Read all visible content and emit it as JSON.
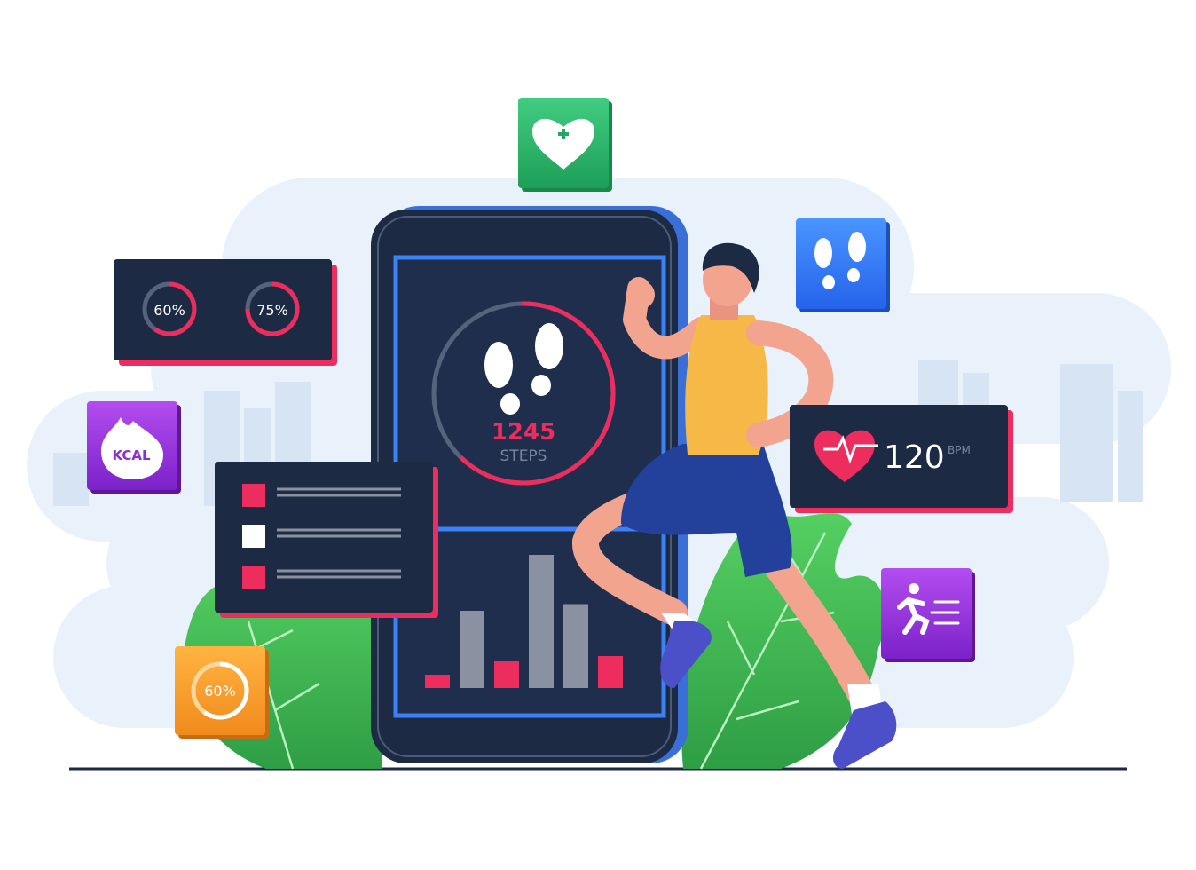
{
  "colors": {
    "navy": "#1d2a44",
    "pink": "#ec2d5d",
    "blue": "#3b82f6",
    "green": "#22a861",
    "purple": "#8b2fd1",
    "orange": "#f59b28",
    "cloud": "#e8f0fa",
    "leaf": "#3fbf4f",
    "skin": "#f2a48f",
    "shirt": "#f6b847",
    "shorts": "#23419a"
  },
  "gauges": {
    "left_pct": "60%",
    "right_pct": "75%",
    "left_value": 0.6,
    "right_value": 0.75
  },
  "kcal_badge": {
    "label": "KCAL",
    "icon": "flame-icon"
  },
  "progress_badge": {
    "pct": "60%",
    "value": 0.6
  },
  "phone": {
    "steps_value": "1245",
    "steps_label": "STEPS",
    "steps_progress": 0.62,
    "bars": [
      {
        "value": 1,
        "color": "pink"
      },
      {
        "value": 5.8,
        "color": "gray"
      },
      {
        "value": 2,
        "color": "pink"
      },
      {
        "value": 10,
        "color": "gray"
      },
      {
        "value": 6.3,
        "color": "gray"
      },
      {
        "value": 2.4,
        "color": "pink"
      }
    ]
  },
  "checklist": [
    {
      "checked": true
    },
    {
      "checked": false
    },
    {
      "checked": true
    }
  ],
  "heart_rate": {
    "value": "120",
    "unit": "BPM"
  },
  "icons": {
    "health": "heart-plus-icon",
    "steps": "footprints-icon",
    "running": "runner-icon"
  }
}
